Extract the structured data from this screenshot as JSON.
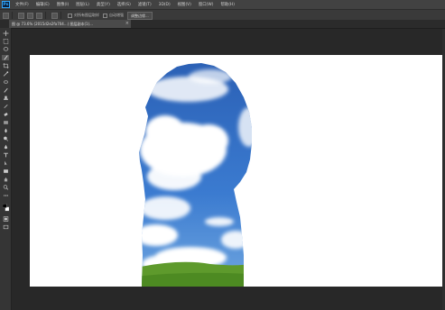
{
  "app": {
    "logo_text": "Ps"
  },
  "menu": {
    "items": [
      "文件(F)",
      "编辑(E)",
      "图像(I)",
      "图层(L)",
      "类型(Y)",
      "选择(S)",
      "滤镜(T)",
      "3D(D)",
      "视图(V)",
      "窗口(W)",
      "帮助(H)"
    ]
  },
  "options": {
    "checkbox_label": "对所有图层取样",
    "enhance_button": "自动增强",
    "refine_button": "调整边缘..."
  },
  "document": {
    "tab_title": "图 @ 73.6% (2015d2e2fa704...)  图层副本(1)...",
    "tab_close": "×"
  },
  "colors": {
    "sky_top": "#2a5fb4",
    "sky_bottom": "#6fa6e0",
    "grass": "#5e9a2c",
    "ui_bg": "#282828"
  }
}
